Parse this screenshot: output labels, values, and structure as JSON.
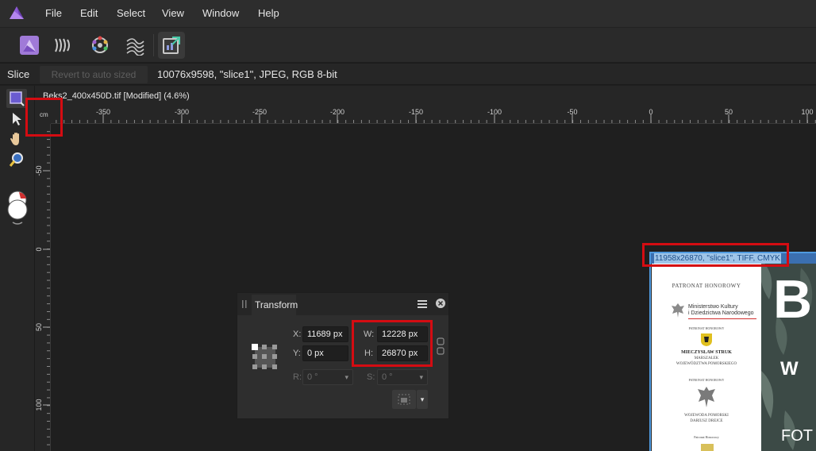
{
  "menu": [
    "File",
    "Edit",
    "Select",
    "View",
    "Window",
    "Help"
  ],
  "context_bar": {
    "tool_name": "Slice",
    "revert_button": "Revert to auto sized",
    "slice_info": "10076x9598, \"slice1\", JPEG, RGB 8-bit"
  },
  "document_tab": {
    "title": "Beks2_400x450D.tif [Modified] (4.6%)"
  },
  "ruler": {
    "unit": "cm",
    "h_ticks": [
      "-350",
      "-300",
      "-250",
      "-200",
      "-150",
      "-100",
      "-50",
      "0",
      "50",
      "100"
    ],
    "v_ticks": [
      "-50",
      "0",
      "50",
      "100"
    ]
  },
  "slice_label": "11958x26870, \"slice1\", TIFF, CMYK",
  "page_text": {
    "heading": "PATRONAT HONOROWY",
    "ministry_line1": "Ministerstwo Kultury",
    "ministry_line2": "i Dziedzictwa Narodowego",
    "patronat_small": "PATRONAT HONOROWY",
    "person1": "MIECZYSŁAW STRUK",
    "person1_role1": "MARSZAŁEK",
    "person1_role2": "WOJEWÓDZTWA POMORSKIEGO",
    "patronat_small2": "PATRONAT HONOROWY",
    "person2_role1": "WOJEWODA POMORSKI",
    "person2_name": "DARIUSZ DREJCE",
    "patronat_small3": "Patronat Honorowy",
    "photo_big": "B",
    "photo_mid": "W",
    "photo_low": "FOT"
  },
  "transform": {
    "title": "Transform",
    "x_label": "X:",
    "x_value": "11689 px",
    "y_label": "Y:",
    "y_value": "0 px",
    "w_label": "W:",
    "w_value": "12228 px",
    "h_label": "H:",
    "h_value": "26870 px",
    "r_label": "R:",
    "r_value": "0 °",
    "s_label": "S:",
    "s_value": "0 °"
  },
  "colors": {
    "highlight": "#d40c12",
    "slice_blue": "#3b6fb0",
    "app_purple": "#8e5bd6"
  },
  "icons": [
    "app-logo-icon",
    "photo-persona-icon",
    "liquify-persona-icon",
    "develop-persona-icon",
    "tone-mapping-persona-icon",
    "export-persona-icon",
    "slice-tool-icon",
    "move-tool-icon",
    "hand-tool-icon",
    "zoom-tool-icon",
    "color-swatch-icon",
    "panel-menu-icon",
    "close-icon",
    "link-icon",
    "anchor-icon"
  ]
}
